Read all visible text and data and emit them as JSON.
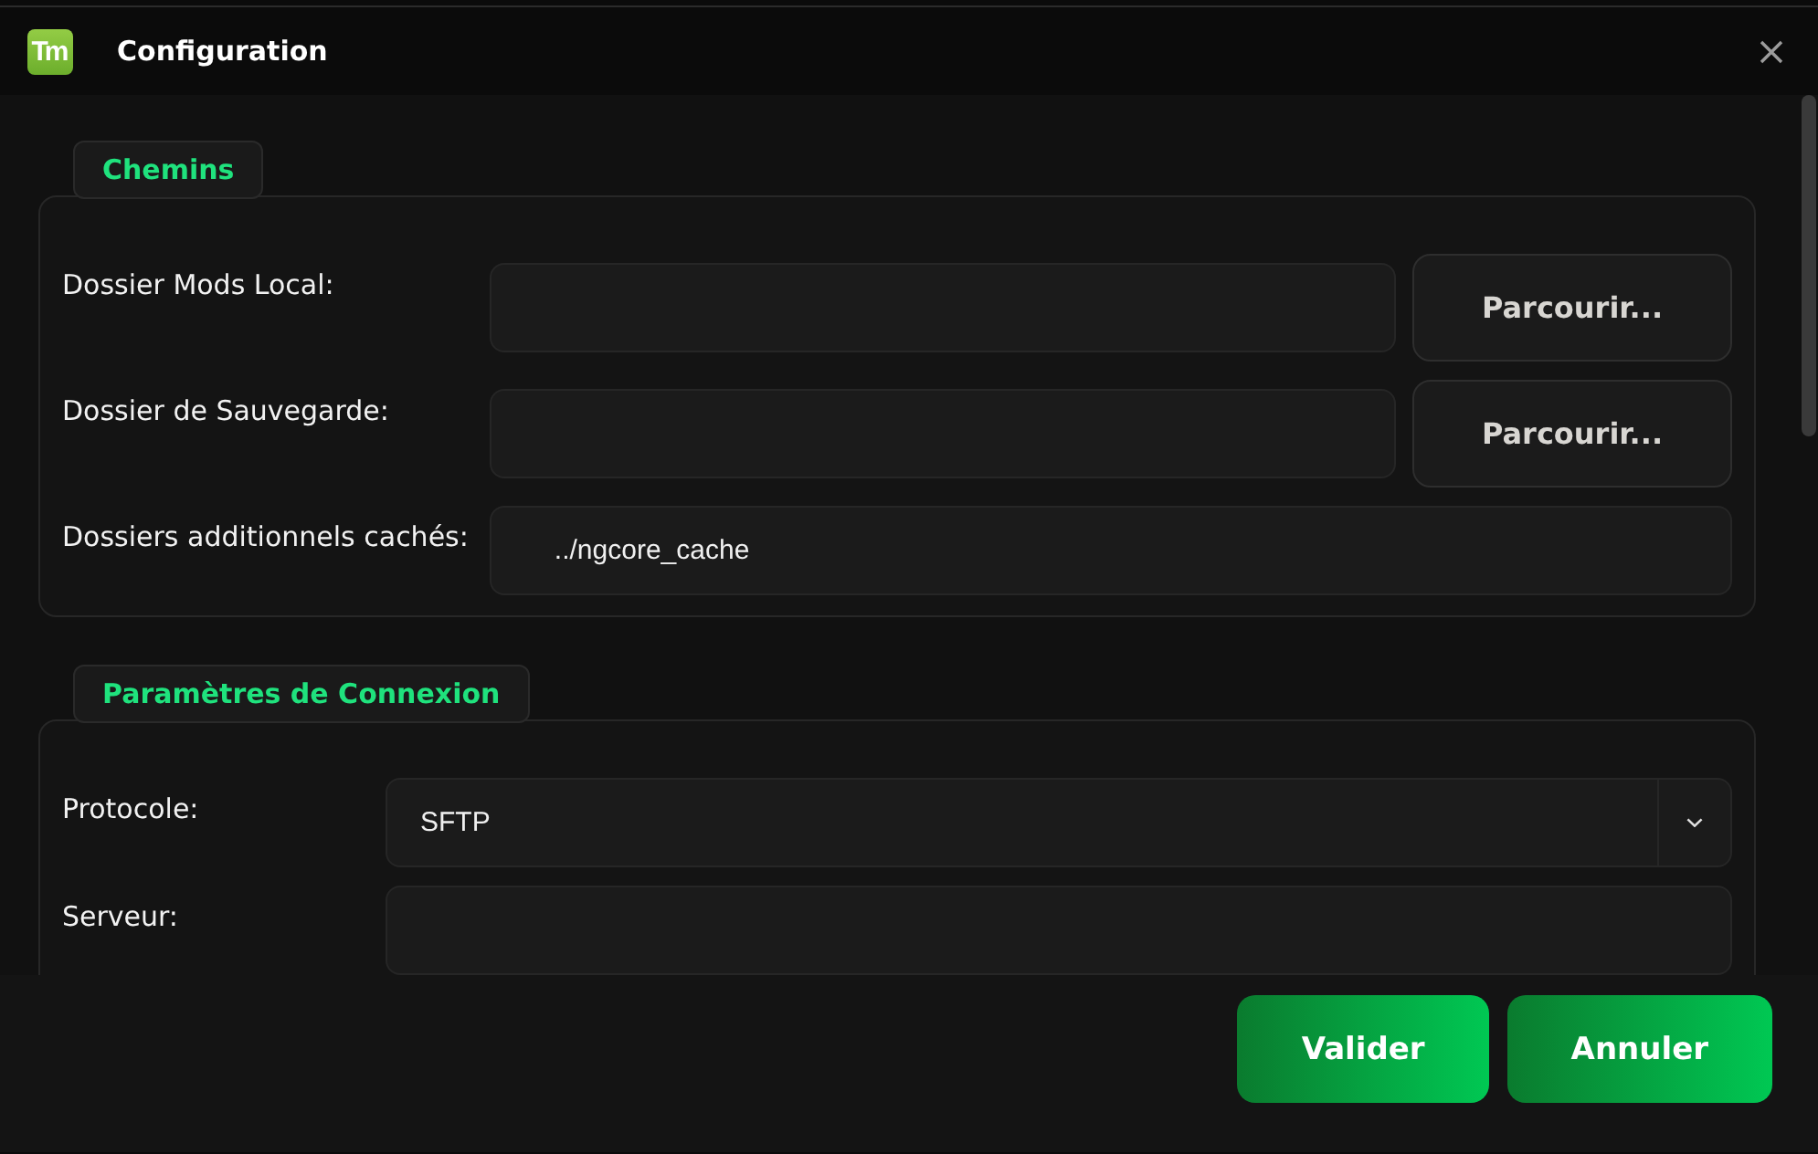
{
  "window": {
    "logo": "Tm",
    "title": "Configuration"
  },
  "sections": [
    {
      "title": "Chemins",
      "fields": [
        {
          "kind": "path",
          "label": "Dossier Mods Local:",
          "button": "Parcourir..."
        },
        {
          "kind": "path",
          "label": "Dossier de Sauvegarde:",
          "button": "Parcourir..."
        },
        {
          "kind": "text",
          "label": "Dossiers additionnels cachés:",
          "value": "../ngcore_cache"
        }
      ]
    },
    {
      "title": "Paramètres de Connexion",
      "fields": [
        {
          "kind": "select",
          "label": "Protocole:",
          "value": "SFTP"
        },
        {
          "kind": "text",
          "label": "Serveur:"
        }
      ]
    }
  ],
  "buttons": [
    "Valider",
    "Annuler"
  ]
}
